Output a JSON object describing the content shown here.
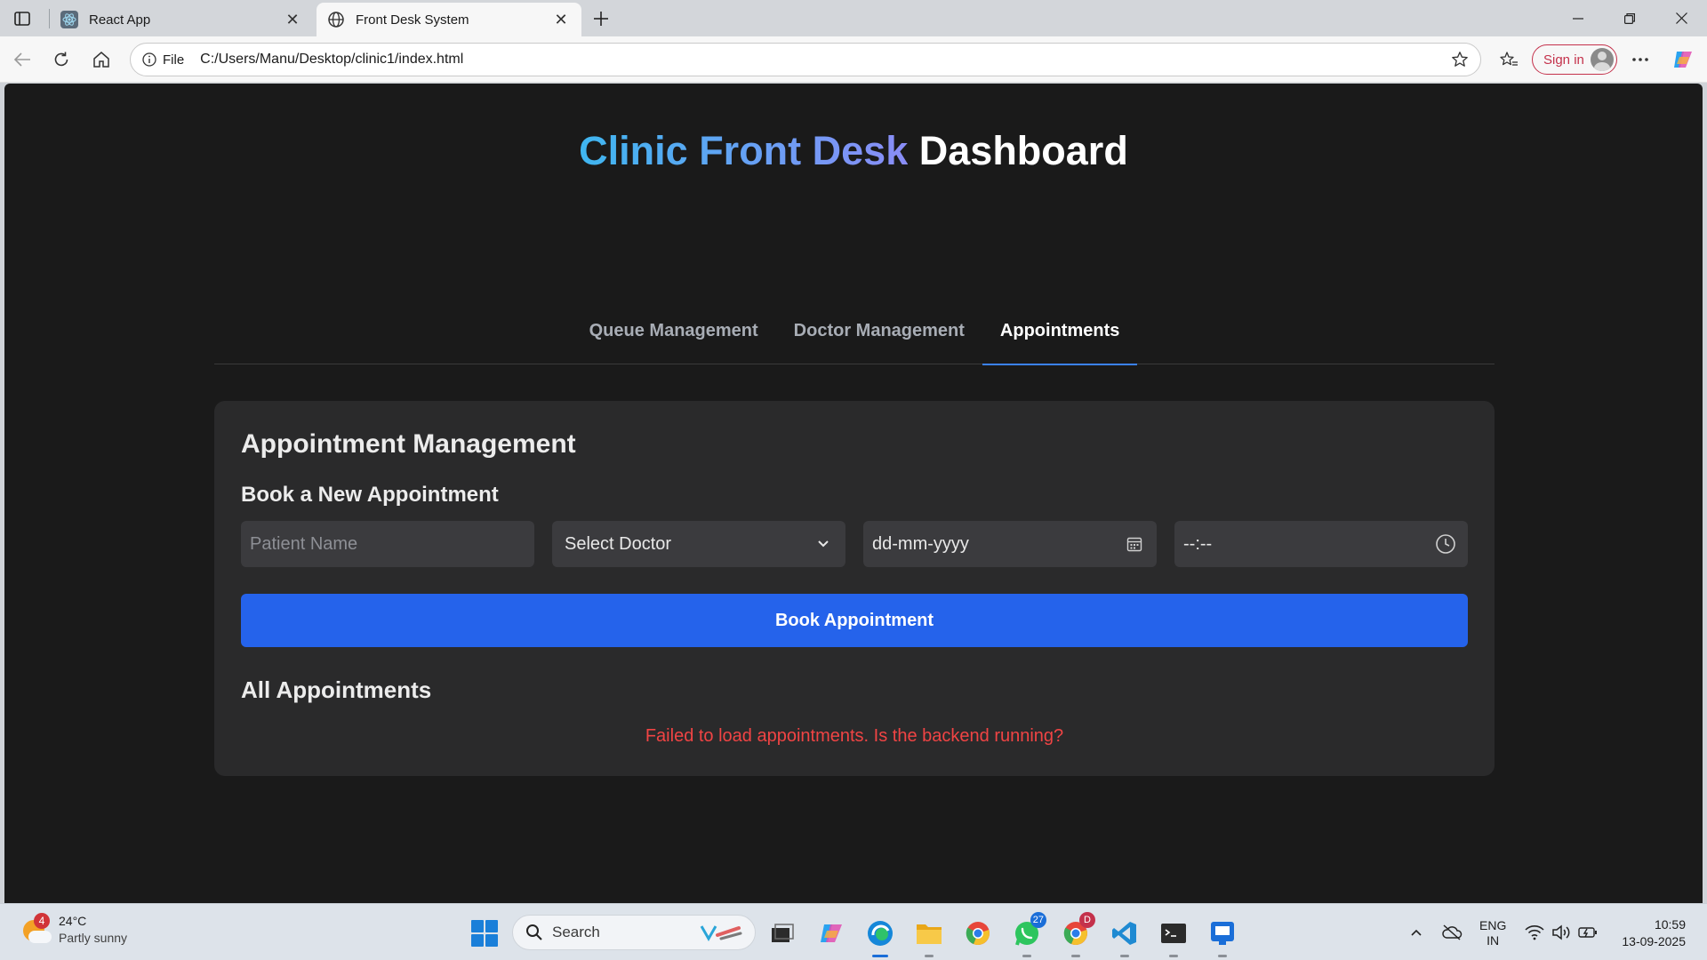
{
  "browser": {
    "tabs": [
      {
        "title": "React App",
        "icon": "react-icon",
        "active": false
      },
      {
        "title": "Front Desk System",
        "icon": "globe-icon",
        "active": true
      }
    ],
    "address": {
      "scheme": "File",
      "url": "C:/Users/Manu/Desktop/clinic1/index.html"
    },
    "signin_label": "Sign in"
  },
  "page": {
    "title_highlight": "Clinic Front Desk",
    "title_rest": "Dashboard",
    "nav_tabs": [
      {
        "label": "Queue Management",
        "active": false
      },
      {
        "label": "Doctor Management",
        "active": false
      },
      {
        "label": "Appointments",
        "active": true
      }
    ],
    "card": {
      "title": "Appointment Management",
      "form_title": "Book a New Appointment",
      "patient_placeholder": "Patient Name",
      "doctor_select": "Select Doctor",
      "date_placeholder": "dd-mm-yyyy",
      "time_placeholder": "--:--",
      "book_button": "Book Appointment",
      "list_title": "All Appointments",
      "error_message": "Failed to load appointments. Is the backend running?"
    },
    "colors": {
      "accent": "#2563eb",
      "error": "#f04444",
      "background": "#1a1a1a",
      "card": "#2a2a2b"
    }
  },
  "taskbar": {
    "weather": {
      "temp": "24°C",
      "condition": "Partly sunny",
      "badge": "4"
    },
    "search_label": "Search",
    "whatsapp_badge": "27",
    "chrome_badge": "D",
    "lang_top": "ENG",
    "lang_bottom": "IN",
    "time": "10:59",
    "date": "13-09-2025"
  }
}
